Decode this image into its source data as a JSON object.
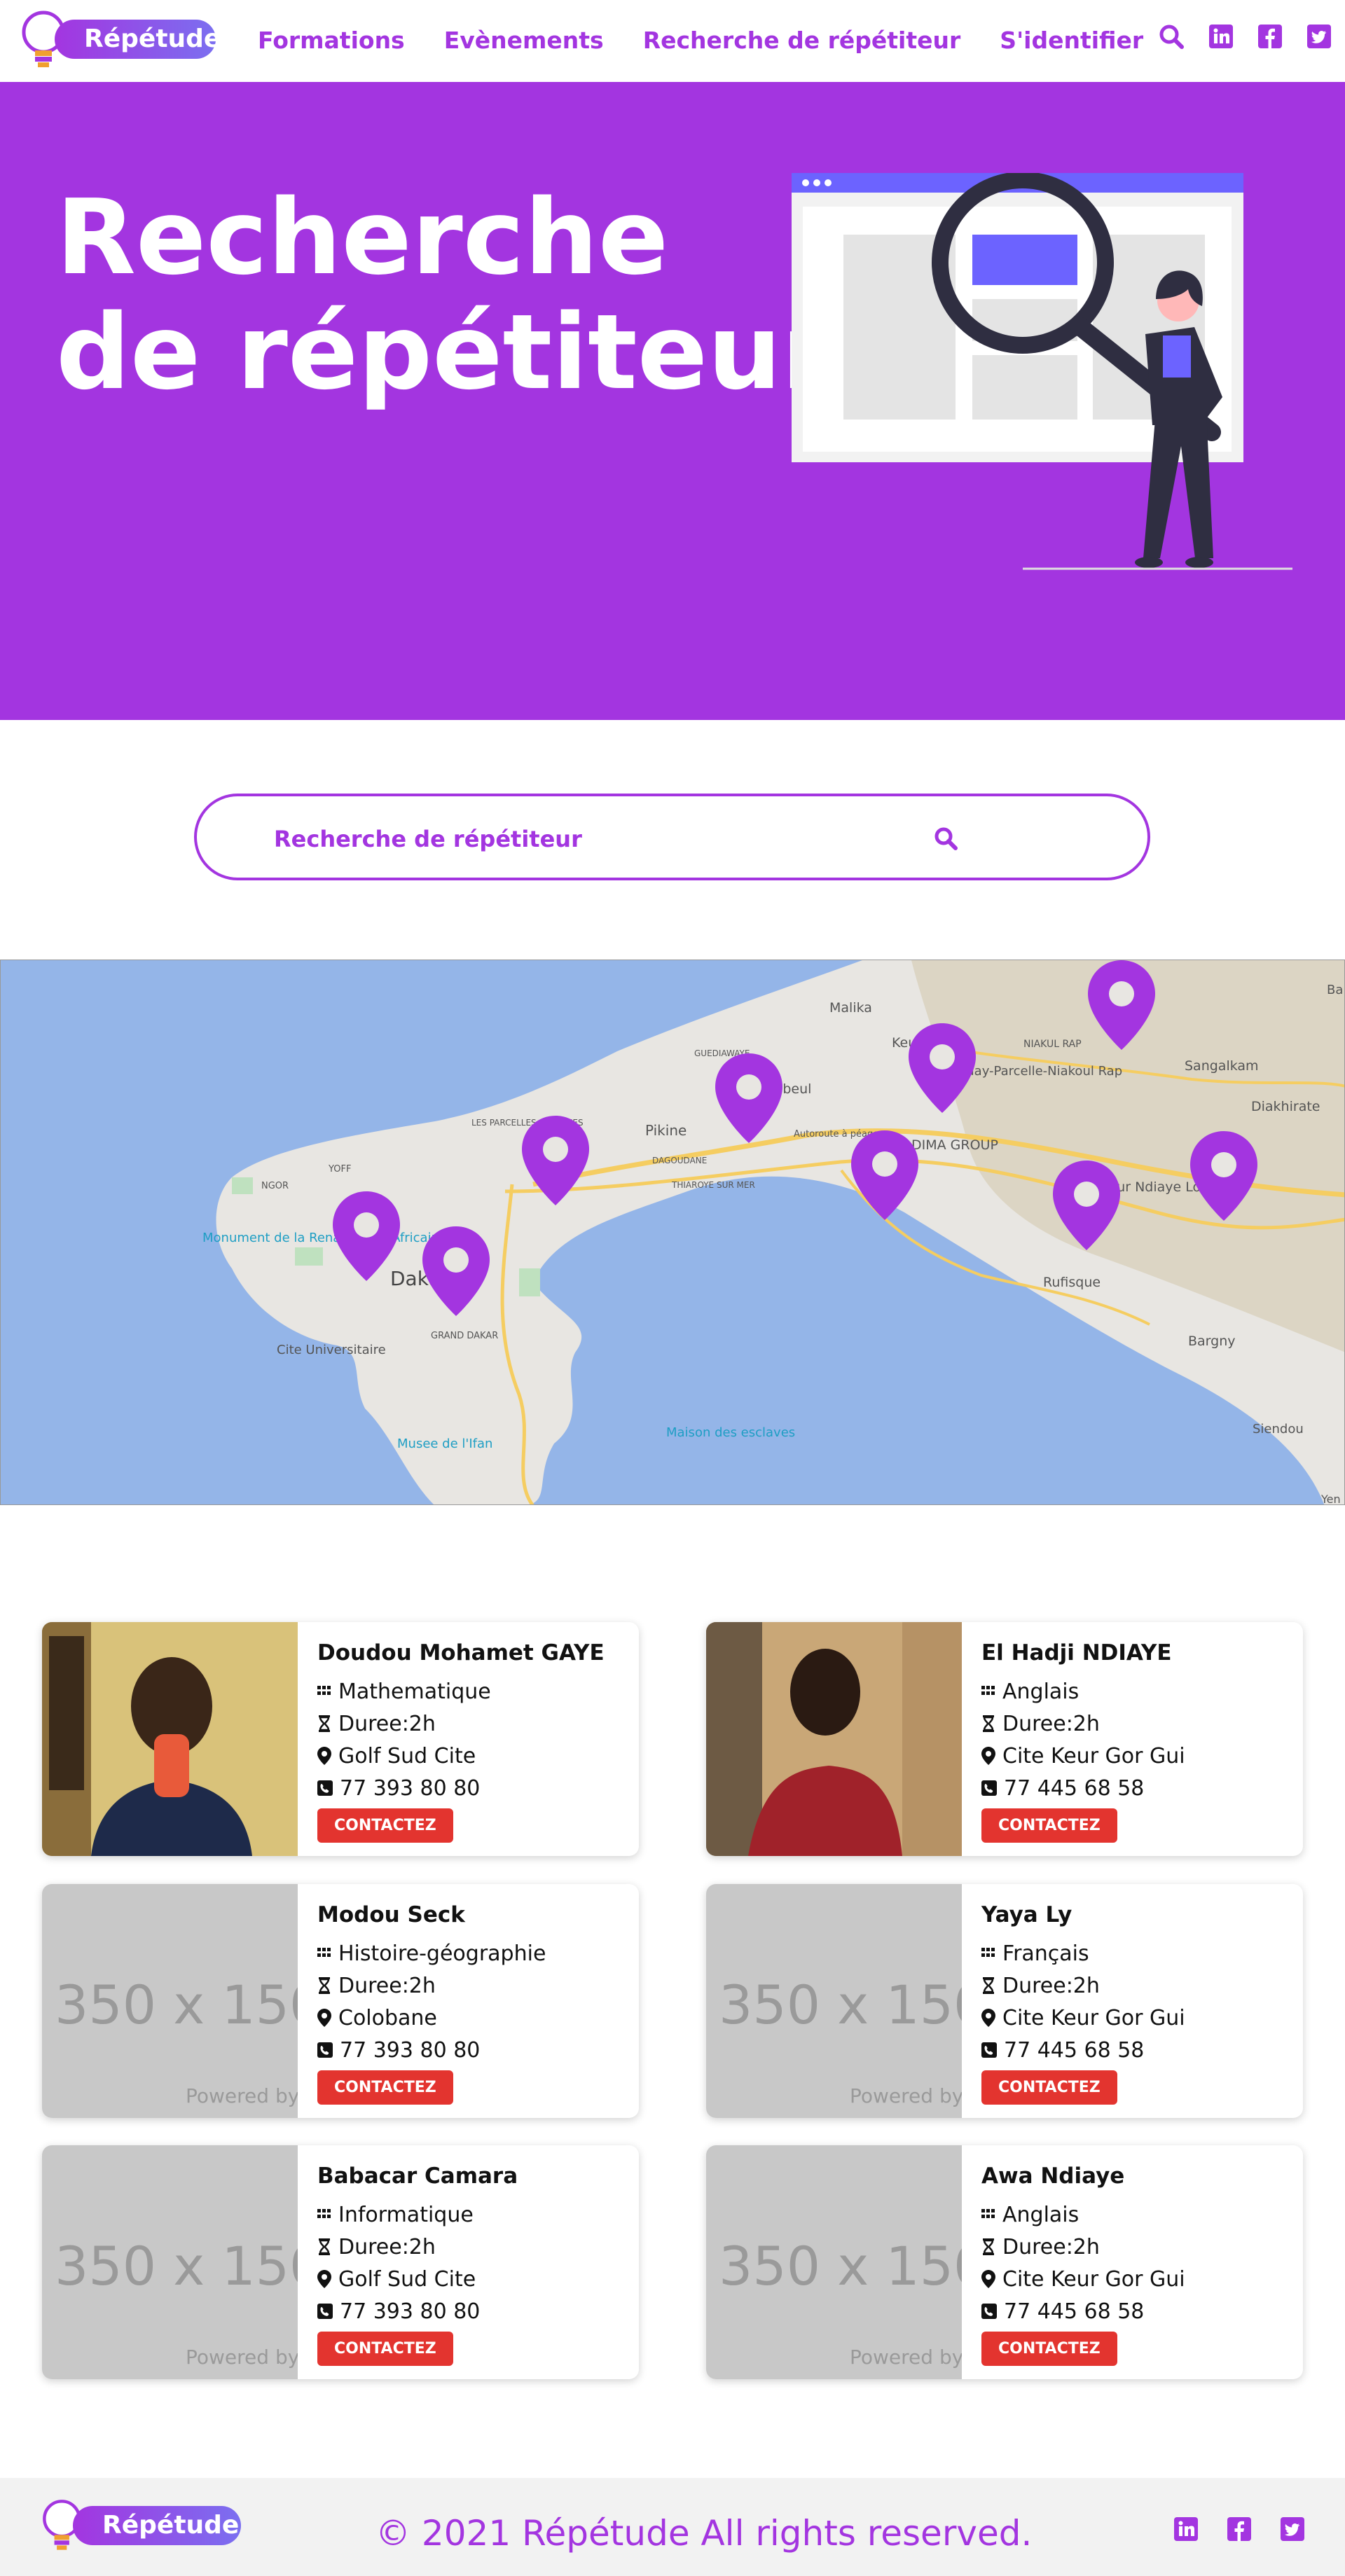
{
  "brand": {
    "name": "Répétude",
    "color": "#a335e0"
  },
  "nav": {
    "links": [
      "Formations",
      "Evènements",
      "Recherche de répétiteur",
      "S'identifier"
    ],
    "icons": [
      "search-icon",
      "linkedin-icon",
      "facebook-icon",
      "twitter-icon"
    ]
  },
  "hero": {
    "title_line1": "Recherche",
    "title_line2": "de répétiteur",
    "background": "#a335e0"
  },
  "search": {
    "placeholder": "Recherche de répétiteur"
  },
  "map": {
    "labels": [
      "Malika",
      "Keur",
      "NIAKUL RAP",
      "Sangalkam",
      "Diakhirate",
      "GUEDIAWAYE",
      "Yeumbeul",
      "Mbaxaay-Parcelle-Niakoul Rap",
      "LES PARCELLES ASSAINIES",
      "Pikine",
      "Autoroute à péage",
      "DIMA GROUP",
      "NGOR",
      "YOFF",
      "THIAROYE SUR MER",
      "DAGOUDANE",
      "Monument de la Renaissance Africaine",
      "Dakar",
      "GRAND DAKAR",
      "Keur Ndiaye Lo",
      "Rufisque",
      "Bargny",
      "Cite Universitaire",
      "Musee de l'Ifan",
      "Maison des esclaves",
      "Siendou",
      "Bar",
      "Yen"
    ]
  },
  "tutors": [
    {
      "name": "Doudou Mohamet GAYE",
      "subject": "Mathematique",
      "duration": "Duree:2h",
      "location": "Golf Sud Cite",
      "phone": "77 393 80 80",
      "photo": "portrait",
      "button": "CONTACTEZ"
    },
    {
      "name": "El Hadji NDIAYE",
      "subject": "Anglais",
      "duration": "Duree:2h",
      "location": "Cite Keur Gor Gui",
      "phone": "77 445 68 58",
      "photo": "portrait",
      "button": "CONTACTEZ"
    },
    {
      "name": "Modou Seck",
      "subject": "Histoire-géographie",
      "duration": "Duree:2h",
      "location": "Colobane",
      "phone": "77 393 80 80",
      "photo": "placeholder",
      "button": "CONTACTEZ"
    },
    {
      "name": "Yaya Ly",
      "subject": "Français",
      "duration": "Duree:2h",
      "location": "Cite Keur Gor Gui",
      "phone": "77 445 68 58",
      "photo": "placeholder",
      "button": "CONTACTEZ"
    },
    {
      "name": "Babacar Camara",
      "subject": "Informatique",
      "duration": "Duree:2h",
      "location": "Golf Sud Cite",
      "phone": "77 393 80 80",
      "photo": "placeholder",
      "button": "CONTACTEZ"
    },
    {
      "name": "Awa Ndiaye",
      "subject": "Anglais",
      "duration": "Duree:2h",
      "location": "Cite Keur Gor Gui",
      "phone": "77 445 68 58",
      "photo": "placeholder",
      "button": "CONTACTEZ"
    }
  ],
  "placeholder": {
    "text": "350 x 150",
    "powered": "Powered by"
  },
  "footer": {
    "copyright": "© 2021 Répétude All rights reserved."
  },
  "colors": {
    "accent": "#a335e0",
    "button": "#e3342f",
    "water": "#94b5e8",
    "land": "#e8e6e2"
  }
}
